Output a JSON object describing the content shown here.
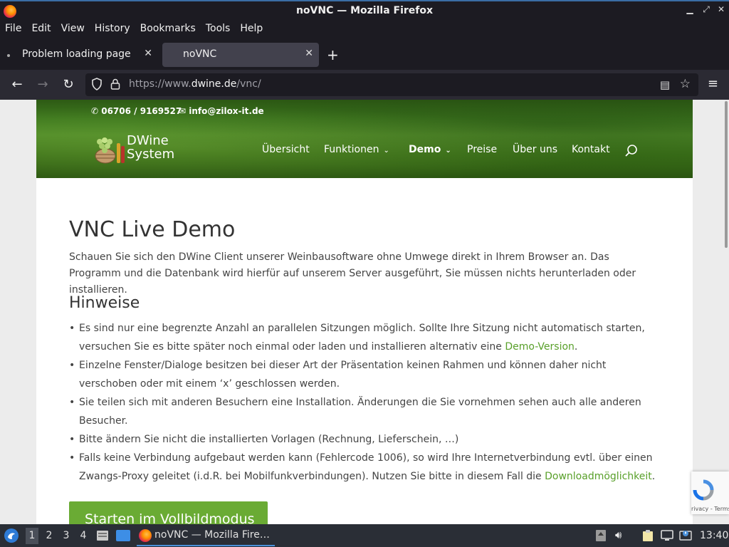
{
  "window": {
    "title": "noVNC — Mozilla Firefox"
  },
  "menubar": [
    "File",
    "Edit",
    "View",
    "History",
    "Bookmarks",
    "Tools",
    "Help"
  ],
  "tabs": [
    {
      "label": "Problem loading page",
      "active": false
    },
    {
      "label": "noVNC",
      "active": true
    }
  ],
  "urlbar": {
    "prefix": "https://www.",
    "domain": "dwine.de",
    "path": "/vnc/"
  },
  "site": {
    "phone": "06706 / 9169527",
    "email": "info@zilox-it.de",
    "logo_line1": "DWine",
    "logo_line2": "System",
    "nav": [
      "Übersicht",
      "Funktionen",
      "Demo",
      "Preise",
      "Über uns",
      "Kontakt"
    ],
    "title": "VNC Live Demo",
    "intro": "Schauen Sie sich den DWine Client unserer Weinbausoftware ohne Umwege direkt in Ihrem Browser an. Das Programm und die Datenbank wird hierfür auf unserem Server ausgeführt, Sie müssen nichts herunterladen oder installieren.",
    "subtitle": "Hinweise",
    "bullets": {
      "b1_text": "Es sind nur eine begrenzte Anzahl an parallelen Sitzungen möglich. Sollte Ihre Sitzung nicht automatisch starten, versuchen Sie es bitte später noch einmal oder laden und installieren alternativ eine ",
      "b1_link": "Demo-Version",
      "b2": "Einzelne Fenster/Dialoge besitzen bei dieser Art der Präsentation keinen Rahmen und können daher nicht verschoben oder mit einem ‘x’ geschlossen werden.",
      "b3": "Sie teilen sich mit anderen Besuchern eine Installation. Änderungen die Sie vornehmen sehen auch alle anderen Besucher.",
      "b4": "Bitte ändern Sie nicht die installierten Vorlagen (Rechnung, Lieferschein, …)",
      "b5_text": "Falls keine Verbindung aufgebaut werden kann (Fehlercode 1006), so wird Ihre Internetverbindung evtl. über einen Zwangs-Proxy geleitet (i.d.R. bei Mobilfunkverbindungen). Nutzen Sie bitte in diesem Fall die ",
      "b5_link": "Downloadmöglichkeit"
    },
    "cta": "Starten im Vollbildmodus",
    "recaptcha": "rivacy - Terms"
  },
  "taskbar": {
    "workspaces": [
      "1",
      "2",
      "3",
      "4"
    ],
    "active_task": "noVNC — Mozilla Fire…",
    "clock": "13:40"
  },
  "colors": {
    "accent_green": "#59a02a",
    "button_green": "#6aab34",
    "tab_active": "#42414d"
  }
}
